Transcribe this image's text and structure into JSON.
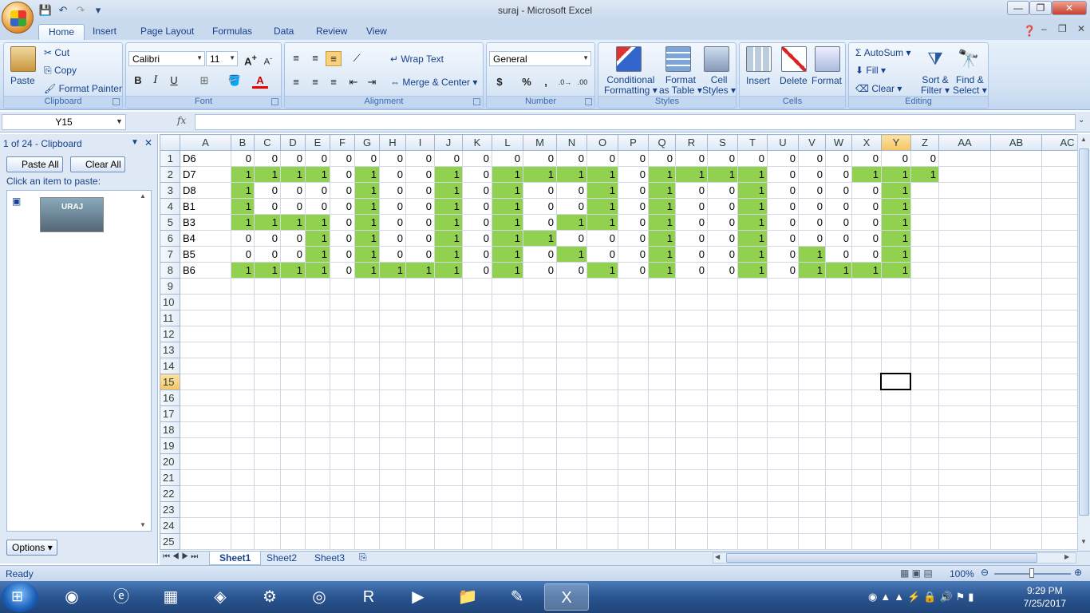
{
  "window": {
    "title": "suraj - Microsoft Excel"
  },
  "qat": {
    "save": "💾",
    "undo": "↶",
    "redo": "↷",
    "customize": "▾"
  },
  "tabs": [
    "Home",
    "Insert",
    "Page Layout",
    "Formulas",
    "Data",
    "Review",
    "View"
  ],
  "ribbon": {
    "clipboard": {
      "label": "Clipboard",
      "paste": "Paste",
      "cut": "Cut",
      "copy": "Copy",
      "format_painter": "Format Painter"
    },
    "font": {
      "label": "Font",
      "name": "Calibri",
      "size": "11",
      "bold": "B",
      "italic": "I",
      "underline": "U"
    },
    "alignment": {
      "label": "Alignment",
      "wrap_text": "Wrap Text",
      "merge_center": "Merge & Center"
    },
    "number": {
      "label": "Number",
      "format": "General",
      "currency": "$",
      "percent": "%",
      "comma": ","
    },
    "styles": {
      "label": "Styles",
      "conditional1": "Conditional",
      "conditional2": "Formatting",
      "format_table1": "Format",
      "format_table2": "as Table",
      "cell_styles1": "Cell",
      "cell_styles2": "Styles"
    },
    "cells": {
      "label": "Cells",
      "insert": "Insert",
      "delete": "Delete",
      "format": "Format"
    },
    "editing": {
      "label": "Editing",
      "autosum": "AutoSum",
      "fill": "Fill",
      "clear": "Clear",
      "sort1": "Sort &",
      "sort2": "Filter",
      "find1": "Find &",
      "find2": "Select"
    }
  },
  "formula_bar": {
    "name_box": "Y15",
    "fx": "fx",
    "value": ""
  },
  "task_pane": {
    "title": "1 of 24 - Clipboard",
    "paste_all": "Paste All",
    "clear_all": "Clear All",
    "hint": "Click an item to paste:",
    "options": "Options",
    "thumb_text": "URAJ"
  },
  "grid": {
    "columns": [
      "A",
      "B",
      "C",
      "D",
      "E",
      "F",
      "G",
      "H",
      "I",
      "J",
      "K",
      "L",
      "M",
      "N",
      "O",
      "P",
      "Q",
      "R",
      "S",
      "T",
      "U",
      "V",
      "W",
      "X",
      "Y",
      "Z",
      "AA",
      "AB",
      "AC"
    ],
    "selected_column": "Y",
    "selected_row": 15,
    "row_count": 25,
    "fill_color": "#92d050",
    "labels": [
      "D6",
      "D7",
      "D8",
      "B1",
      "B3",
      "B4",
      "B5",
      "B6"
    ],
    "rows": [
      [
        0,
        0,
        0,
        0,
        0,
        0,
        0,
        0,
        0,
        0,
        0,
        0,
        0,
        0,
        0,
        0,
        0,
        0,
        0,
        0,
        0,
        0,
        0,
        0,
        0
      ],
      [
        1,
        1,
        1,
        1,
        0,
        1,
        0,
        0,
        1,
        0,
        1,
        1,
        1,
        1,
        0,
        1,
        1,
        1,
        1,
        0,
        0,
        0,
        1,
        1,
        1
      ],
      [
        1,
        0,
        0,
        0,
        0,
        1,
        0,
        0,
        1,
        0,
        1,
        0,
        0,
        1,
        0,
        1,
        0,
        0,
        1,
        0,
        0,
        0,
        0,
        1,
        null
      ],
      [
        1,
        0,
        0,
        0,
        0,
        1,
        0,
        0,
        1,
        0,
        1,
        0,
        0,
        1,
        0,
        1,
        0,
        0,
        1,
        0,
        0,
        0,
        0,
        1,
        null
      ],
      [
        1,
        1,
        1,
        1,
        0,
        1,
        0,
        0,
        1,
        0,
        1,
        0,
        1,
        1,
        0,
        1,
        0,
        0,
        1,
        0,
        0,
        0,
        0,
        1,
        null
      ],
      [
        0,
        0,
        0,
        1,
        0,
        1,
        0,
        0,
        1,
        0,
        1,
        1,
        0,
        0,
        0,
        1,
        0,
        0,
        1,
        0,
        0,
        0,
        0,
        1,
        null
      ],
      [
        0,
        0,
        0,
        1,
        0,
        1,
        0,
        0,
        1,
        0,
        1,
        0,
        1,
        0,
        0,
        1,
        0,
        0,
        1,
        0,
        1,
        0,
        0,
        1,
        null
      ],
      [
        1,
        1,
        1,
        1,
        0,
        1,
        1,
        1,
        1,
        0,
        1,
        0,
        0,
        1,
        0,
        1,
        0,
        0,
        1,
        0,
        1,
        1,
        1,
        1,
        null
      ]
    ],
    "green": [
      [],
      [
        0,
        1,
        2,
        3,
        5,
        8,
        10,
        11,
        12,
        13,
        15,
        16,
        17,
        18,
        22,
        23,
        24
      ],
      [
        0,
        5,
        8,
        10,
        13,
        15,
        18,
        23
      ],
      [
        0,
        5,
        8,
        10,
        13,
        15,
        18,
        23
      ],
      [
        0,
        1,
        2,
        3,
        5,
        8,
        10,
        12,
        13,
        15,
        18,
        23
      ],
      [
        3,
        5,
        8,
        10,
        11,
        15,
        18,
        23
      ],
      [
        3,
        5,
        8,
        10,
        12,
        15,
        18,
        20,
        23
      ],
      [
        0,
        1,
        2,
        3,
        5,
        6,
        7,
        8,
        10,
        13,
        15,
        18,
        20,
        21,
        22,
        23
      ]
    ]
  },
  "sheets": [
    "Sheet1",
    "Sheet2",
    "Sheet3"
  ],
  "status": {
    "ready": "Ready",
    "zoom": "100%"
  },
  "clock": {
    "time": "9:29 PM",
    "date": "7/25/2017"
  }
}
